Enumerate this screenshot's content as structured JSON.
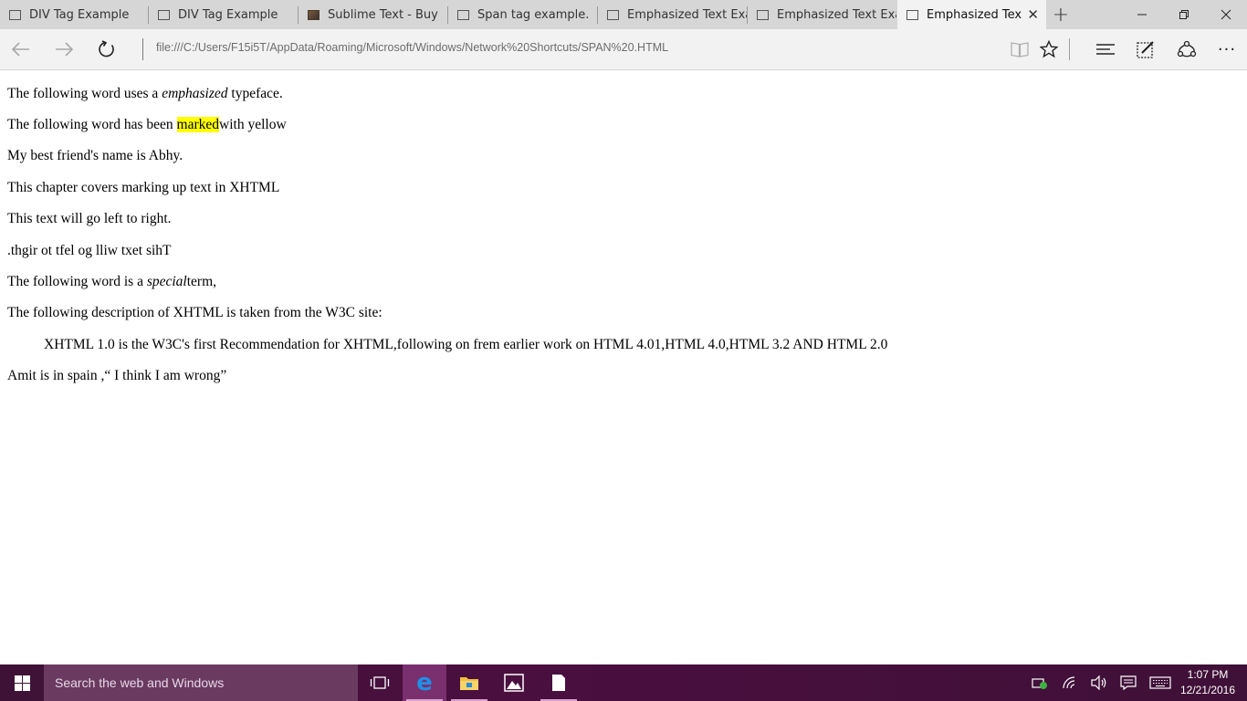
{
  "tabs": [
    {
      "label": "DIV Tag Example",
      "icon": "page-icon",
      "active": false
    },
    {
      "label": "DIV Tag Example",
      "icon": "page-icon",
      "active": false
    },
    {
      "label": "Sublime Text - Buy",
      "icon": "sublime-icon",
      "active": false
    },
    {
      "label": "Span tag example.",
      "icon": "page-icon",
      "active": false
    },
    {
      "label": "Emphasized Text Exan",
      "icon": "page-icon",
      "active": false
    },
    {
      "label": "Emphasized Text Exan",
      "icon": "page-icon",
      "active": false
    },
    {
      "label": "Emphasized Text E",
      "icon": "page-icon",
      "active": true
    }
  ],
  "address_bar": {
    "url": "file:///C:/Users/F15i5T/AppData/Roaming/Microsoft/Windows/Network%20Shortcuts/SPAN%20.HTML"
  },
  "page": {
    "line1": {
      "before": "The following word uses a ",
      "em": "emphasized",
      "after": " typeface."
    },
    "line2": {
      "before": "The following word has been ",
      "mark": "marked",
      "after": "with yellow"
    },
    "line3": "My best friend's name is Abhy.",
    "line4": "This chapter covers marking up text in XHTML",
    "line5": "This text will go left to right.",
    "line6": "This text will go left to right.",
    "line7": {
      "before": "The following word is a ",
      "em": "special",
      "after": "term,"
    },
    "line8": "The following description of XHTML is taken from the W3C site:",
    "blockquote": "XHTML 1.0 is the W3C's first Recommendation for XHTML,following on frem earlier work on HTML 4.01,HTML 4.0,HTML 3.2 AND HTML 2.0",
    "line10": "Amit is in spain ,“ I think I am wrong”"
  },
  "taskbar": {
    "search_placeholder": "Search the web and Windows",
    "time": "1:07 PM",
    "date": "12/21/2016"
  },
  "colors": {
    "highlight": "#ffff00",
    "taskbar": "#4a0f3f",
    "edge_blue": "#1e90e8"
  }
}
